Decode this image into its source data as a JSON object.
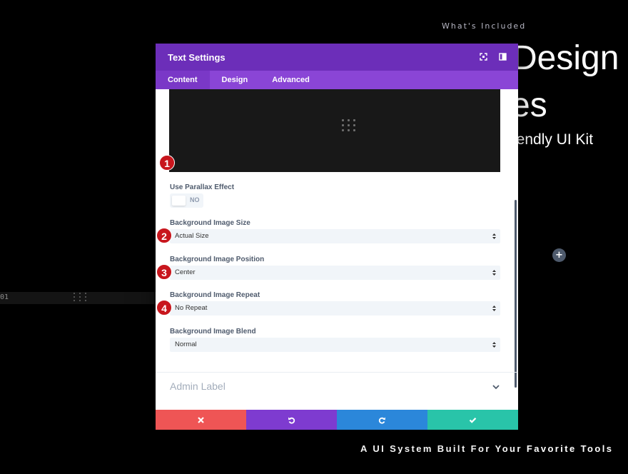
{
  "background": {
    "eyebrow": "What's Included",
    "heading_line1": "Design",
    "heading_line2": "es",
    "subheading": "iendly UI Kit",
    "tagline": "A UI System Built For Your Favorite Tools",
    "row_number": "01",
    "add_button": "+"
  },
  "modal": {
    "title": "Text Settings",
    "tabs": [
      {
        "label": "Content",
        "active": true
      },
      {
        "label": "Design",
        "active": false
      },
      {
        "label": "Advanced",
        "active": false
      }
    ],
    "markers": [
      "1",
      "2",
      "3",
      "4"
    ],
    "fields": {
      "parallax": {
        "label": "Use Parallax Effect",
        "value": "NO"
      },
      "size": {
        "label": "Background Image Size",
        "value": "Actual Size"
      },
      "position": {
        "label": "Background Image Position",
        "value": "Center"
      },
      "repeat": {
        "label": "Background Image Repeat",
        "value": "No Repeat"
      },
      "blend": {
        "label": "Background Image Blend",
        "value": "Normal"
      }
    },
    "admin_label": "Admin Label"
  },
  "icons": {
    "expand": "expand-icon",
    "split": "sidebar-split-icon",
    "drag": "drag-grid-icon",
    "chevron": "chevron-down-icon",
    "cancel": "close-x-icon",
    "undo": "undo-icon",
    "redo": "redo-icon",
    "save": "check-icon"
  },
  "colors": {
    "header": "#6c2eb9",
    "tabs": "#8a45d6",
    "cancel": "#ef5555",
    "undo": "#7e3bd0",
    "redo": "#2b87da",
    "save": "#29c4a9",
    "marker": "#c8161d"
  }
}
